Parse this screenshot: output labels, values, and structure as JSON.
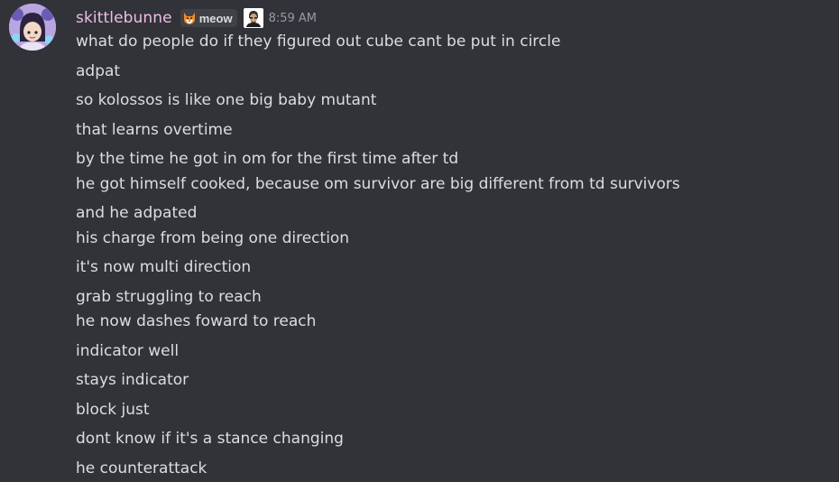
{
  "message": {
    "username": "skittlebunne",
    "tag": {
      "label": "meow",
      "icon": "fox-icon"
    },
    "badge_icon": "portrait-badge-icon",
    "timestamp": "8:59 AM",
    "lines": [
      "what do people do if they figured out cube cant be put in circle",
      "adpat",
      "so kolossos is like one big baby mutant",
      "that learns overtime",
      "by the time he got in om for the first time after td",
      "he got himself cooked, because om survivor are big different from td survivors",
      "and he adpated",
      "his charge from being one direction",
      "it's now multi direction",
      "grab struggling to reach",
      "he now dashes foward to reach",
      "indicator well",
      "stays indicator",
      "block just",
      "dont know if it's a stance changing",
      "he counterattack"
    ]
  },
  "colors": {
    "background": "#313338",
    "username": "#efbde6",
    "text": "#dbdee1",
    "timestamp": "#949ba4",
    "tag_background": "#3f4147"
  }
}
